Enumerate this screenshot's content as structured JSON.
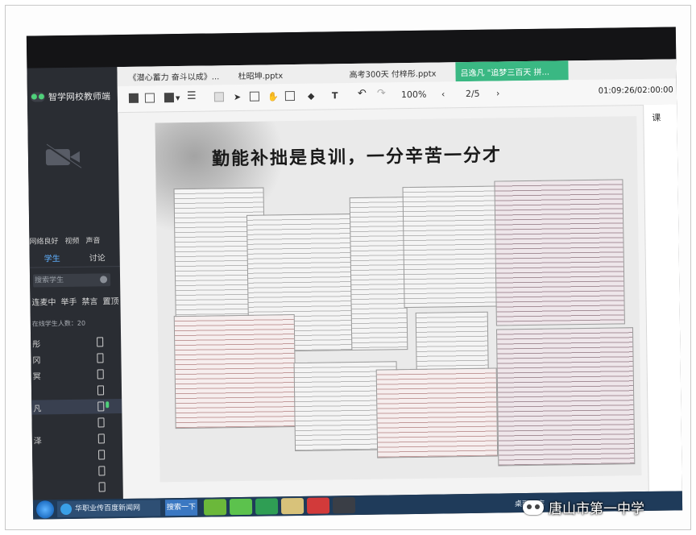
{
  "app": {
    "name": "智学网校教师端"
  },
  "tabs": [
    {
      "label": "《潜心蓄力 奋斗以成》..."
    },
    {
      "label": "杜昭坤.pptx"
    },
    {
      "label": "高考300天 付梓彤.pptx"
    },
    {
      "label": "吕逸凡 \"追梦三百天 拼..."
    }
  ],
  "toolbar": {
    "zoom": "100%",
    "page": "2/5",
    "timer": "01:09:26/02:00:00"
  },
  "sidebar": {
    "net_status": "网络良好",
    "video_label": "视频",
    "audio_label": "声音",
    "tab_students": "学生",
    "tab_discuss": "讨论",
    "search_placeholder": "搜索学生",
    "filters": [
      "连麦中",
      "举手",
      "禁言",
      "置顶"
    ],
    "count_label": "在线学生人数：20",
    "students": [
      "彤",
      "冈",
      "冥",
      "",
      "凡",
      "",
      "泽",
      "",
      "",
      ""
    ]
  },
  "slide": {
    "title": "勤能补拙是良训，一分辛苦一分才"
  },
  "right_panel": {
    "label": "课"
  },
  "taskbar": {
    "browser_label": "华职业传百度新闻网",
    "search_label": "搜索一下",
    "tray_desktop": "桌面",
    "tray_lib": "库"
  },
  "watermark": {
    "text": "唐山市第一中学"
  },
  "colors": {
    "accent": "#3ab883",
    "sidebar_bg": "#2a2d33",
    "highlight": "#5fb0ff"
  }
}
